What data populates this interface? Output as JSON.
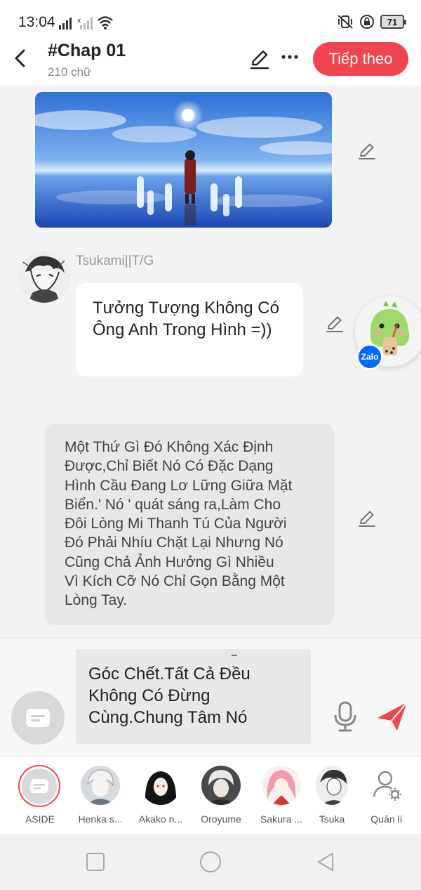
{
  "status_bar": {
    "time": "13:04",
    "battery": "71"
  },
  "header": {
    "title": "#Chap 01",
    "word_count": "210 chữ",
    "next_label": "Tiếp theo"
  },
  "message": {
    "speaker": "Tsukami||T/G",
    "text": "Tưởng Tượng Không Có Ông Anh Trong Hình =))"
  },
  "narration": {
    "lines": [
      "Một Thứ Gì Đó Không Xác Định",
      "Được,Chỉ Biết Nó Có Đặc Dạng",
      "Hình Cầu Đang Lơ Lững Giữa Mặt",
      "Biển.' Nó ' quát sáng ra,Làm Cho",
      "Đôi Lòng Mi Thanh Tú Của Người",
      "Đó Phải Nhíu Chặt Lại Nhưng Nó",
      "Cũng Chả Ảnh Hưởng Gì Nhiều",
      "Vì Kích Cỡ Nó Chỉ Gọn Bằng Một",
      "Lòng Tay."
    ]
  },
  "zalo_badge": "Zalo",
  "compose": {
    "lines": [
      "Góc Chết.Tất Cả Đều",
      "Không Có Đừng",
      "Cùng.Chung Tâm Nó"
    ]
  },
  "characters": [
    {
      "label": "ASIDE"
    },
    {
      "label": "Henka s..."
    },
    {
      "label": "Akako n..."
    },
    {
      "label": "Oroyume"
    },
    {
      "label": "Sakura ..."
    },
    {
      "label": "Tsuka"
    },
    {
      "label": "Quản lí"
    }
  ],
  "colors": {
    "accent": "#f0454e",
    "zalo": "#0068ff"
  }
}
